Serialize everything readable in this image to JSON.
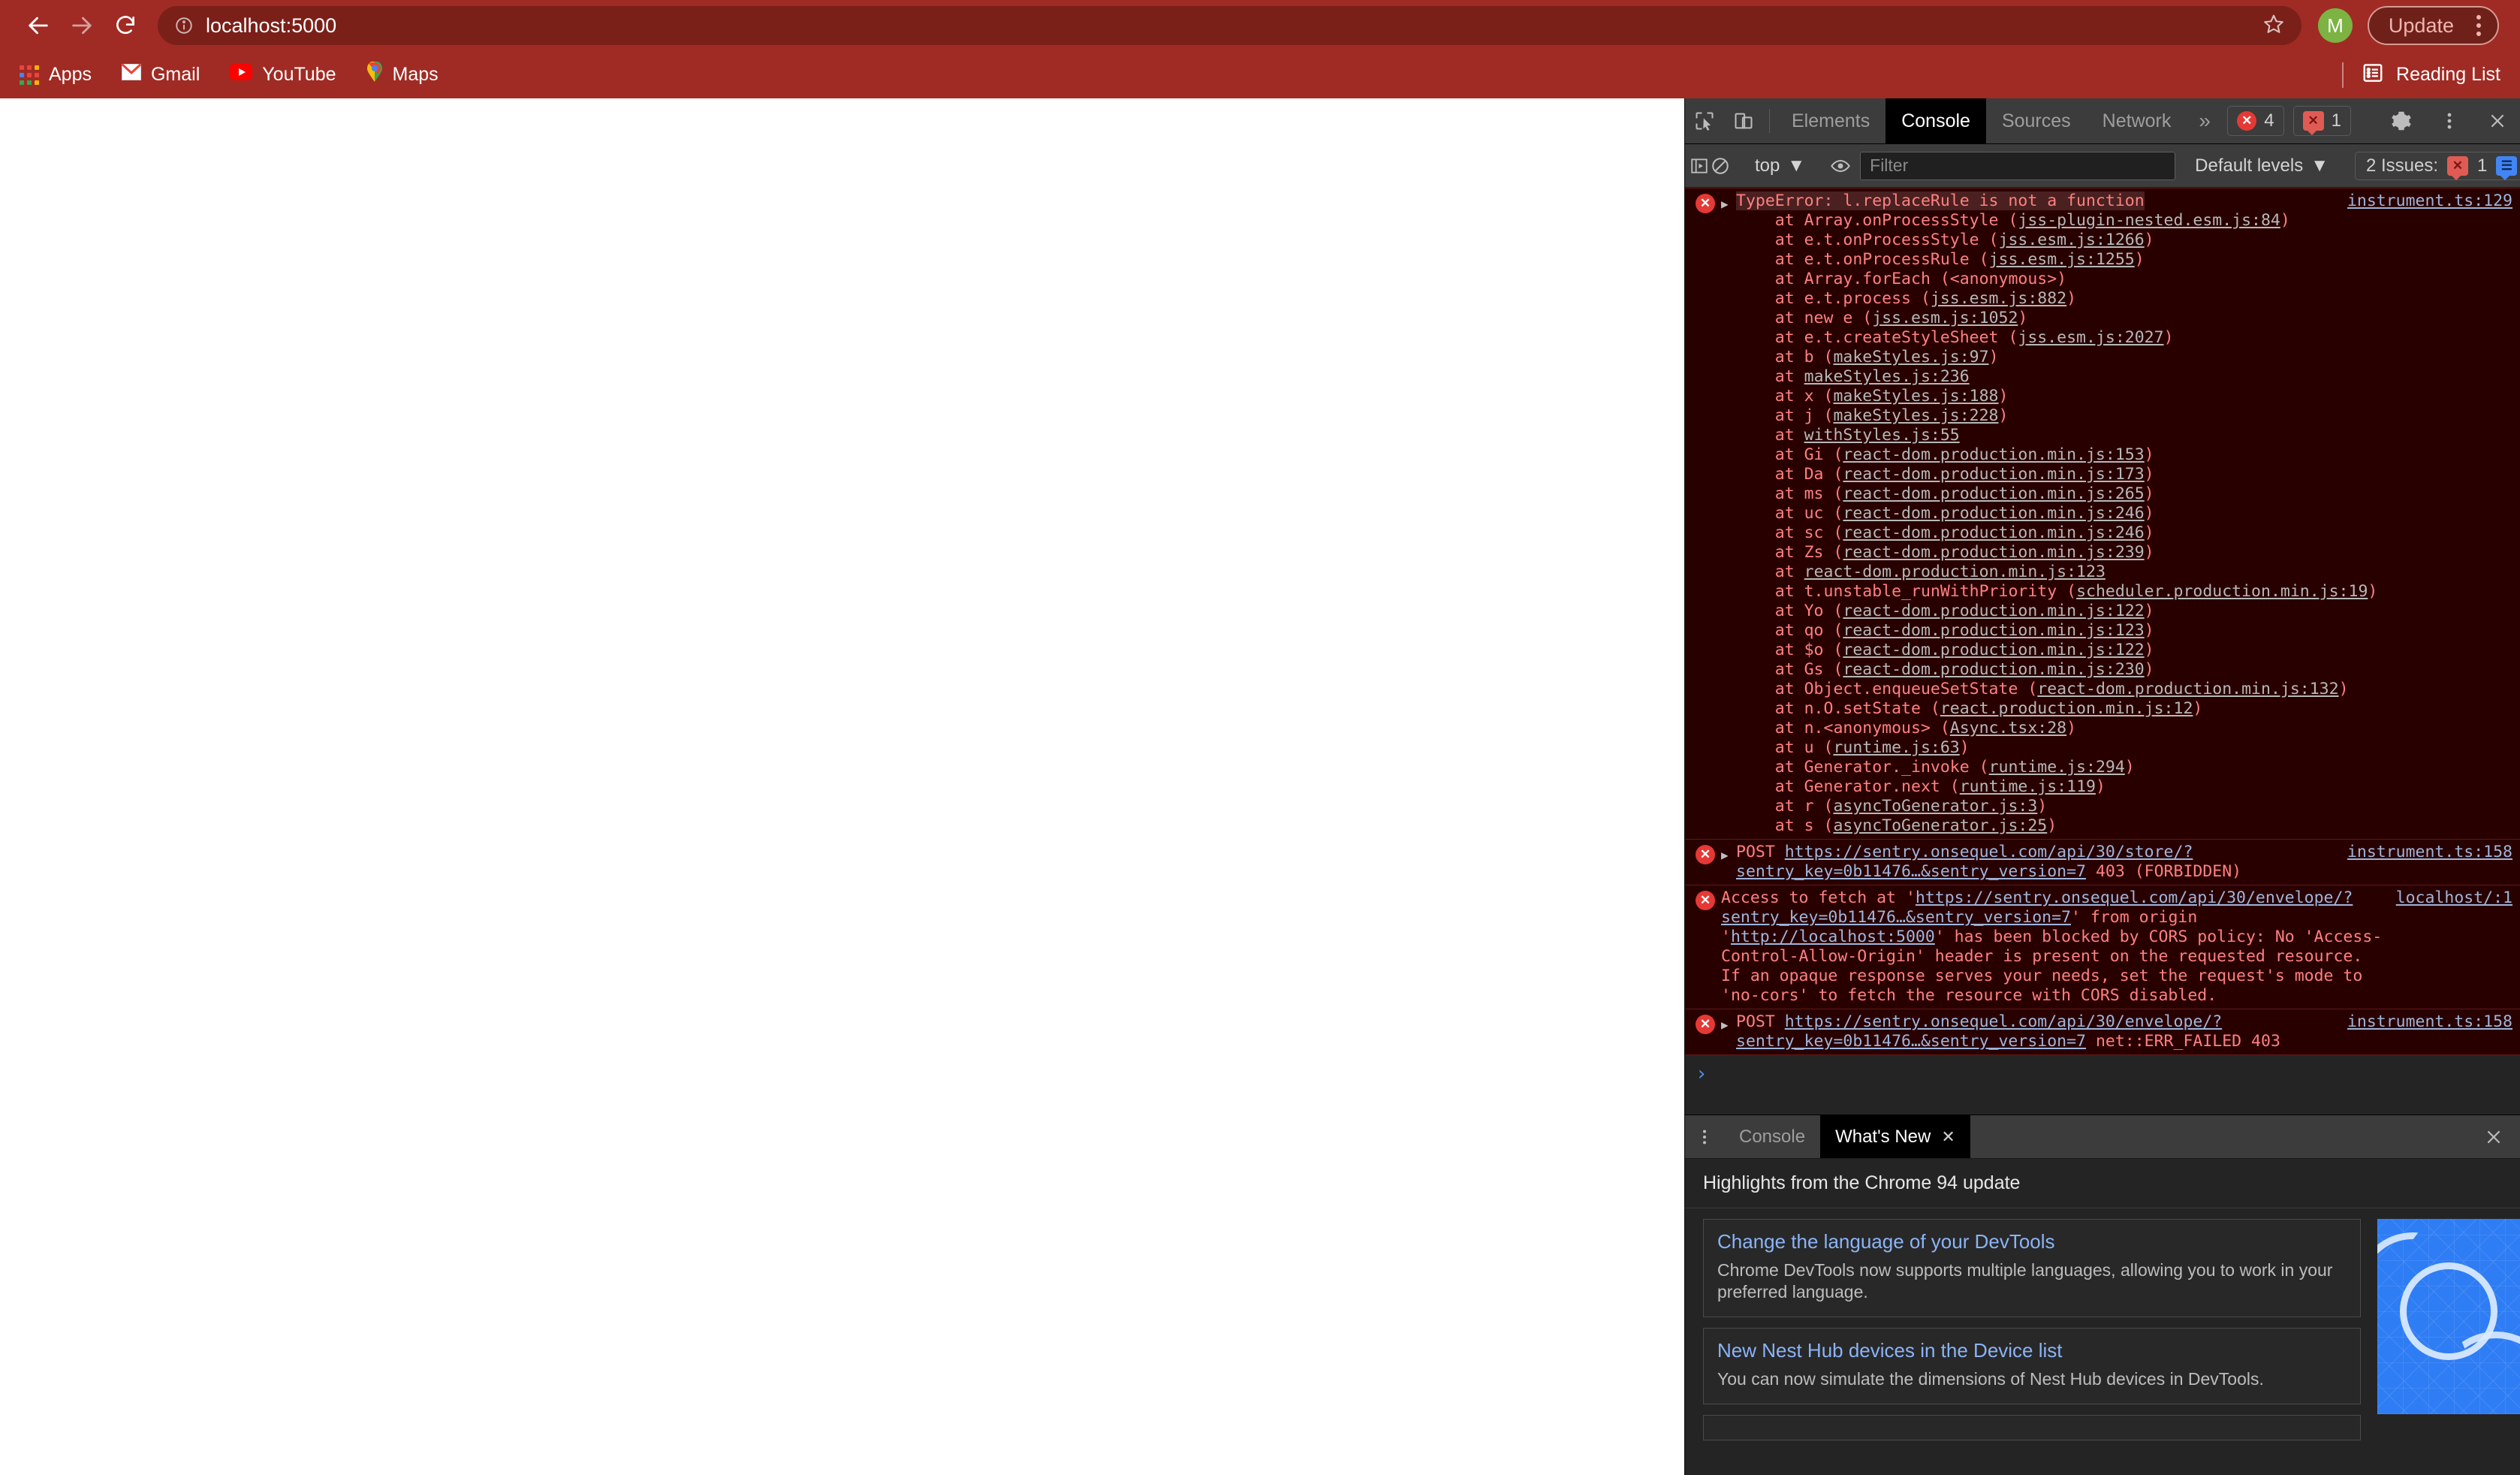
{
  "browser": {
    "nav": {
      "back_icon": "arrow-left-icon",
      "forward_icon": "arrow-right-icon",
      "reload_icon": "reload-icon"
    },
    "omnibox": {
      "url": "localhost:5000",
      "info_icon": "page-info-icon",
      "star_icon": "bookmark-star-icon"
    },
    "profile": {
      "initial": "M"
    },
    "update_button": {
      "label": "Update"
    },
    "menu_icon": "kebab-menu-icon",
    "bookmarks": [
      {
        "label": "Apps",
        "icon": "apps-grid-icon"
      },
      {
        "label": "Gmail",
        "icon": "gmail-icon"
      },
      {
        "label": "YouTube",
        "icon": "youtube-icon"
      },
      {
        "label": "Maps",
        "icon": "maps-pin-icon"
      }
    ],
    "reading_list": {
      "label": "Reading List",
      "icon": "reading-list-icon"
    }
  },
  "devtools": {
    "tabbar": {
      "inspect_icon": "inspect-element-icon",
      "device_icon": "device-toolbar-icon",
      "tabs": [
        {
          "label": "Elements",
          "active": false
        },
        {
          "label": "Console",
          "active": true
        },
        {
          "label": "Sources",
          "active": false
        },
        {
          "label": "Network",
          "active": false
        }
      ],
      "more_tabs_icon": "chevron-double-right-icon",
      "error_count": "4",
      "issue_count": "1",
      "settings_icon": "gear-icon",
      "more_icon": "kebab-menu-icon",
      "close_icon": "close-icon"
    },
    "toolbar": {
      "sidebar_icon": "console-sidebar-icon",
      "clear_icon": "clear-console-icon",
      "context": "top",
      "eye_icon": "live-expression-icon",
      "filter_placeholder": "Filter",
      "filter_value": "",
      "levels": "Default levels",
      "issues_label": "2 Issues:",
      "issues_error_count": "1",
      "issues_info_count": "1",
      "settings_icon": "gear-icon"
    },
    "console": {
      "messages": [
        {
          "type": "error-stack",
          "icon": "error-icon",
          "expandable": true,
          "header": "TypeError: l.replaceRule is not a function",
          "source": "instrument.ts:129",
          "stack": [
            {
              "fn": "at Array.onProcessStyle (",
              "loc": "jss-plugin-nested.esm.js:84",
              "tail": ")"
            },
            {
              "fn": "at e.t.onProcessStyle (",
              "loc": "jss.esm.js:1266",
              "tail": ")"
            },
            {
              "fn": "at e.t.onProcessRule (",
              "loc": "jss.esm.js:1255",
              "tail": ")"
            },
            {
              "fn": "at Array.forEach (<anonymous>)",
              "loc": "",
              "tail": ""
            },
            {
              "fn": "at e.t.process (",
              "loc": "jss.esm.js:882",
              "tail": ")"
            },
            {
              "fn": "at new e (",
              "loc": "jss.esm.js:1052",
              "tail": ")"
            },
            {
              "fn": "at e.t.createStyleSheet (",
              "loc": "jss.esm.js:2027",
              "tail": ")"
            },
            {
              "fn": "at b (",
              "loc": "makeStyles.js:97",
              "tail": ")"
            },
            {
              "fn": "at ",
              "loc": "makeStyles.js:236",
              "tail": ""
            },
            {
              "fn": "at x (",
              "loc": "makeStyles.js:188",
              "tail": ")"
            },
            {
              "fn": "at j (",
              "loc": "makeStyles.js:228",
              "tail": ")"
            },
            {
              "fn": "at ",
              "loc": "withStyles.js:55",
              "tail": ""
            },
            {
              "fn": "at Gi (",
              "loc": "react-dom.production.min.js:153",
              "tail": ")"
            },
            {
              "fn": "at Da (",
              "loc": "react-dom.production.min.js:173",
              "tail": ")"
            },
            {
              "fn": "at ms (",
              "loc": "react-dom.production.min.js:265",
              "tail": ")"
            },
            {
              "fn": "at uc (",
              "loc": "react-dom.production.min.js:246",
              "tail": ")"
            },
            {
              "fn": "at sc (",
              "loc": "react-dom.production.min.js:246",
              "tail": ")"
            },
            {
              "fn": "at Zs (",
              "loc": "react-dom.production.min.js:239",
              "tail": ")"
            },
            {
              "fn": "at ",
              "loc": "react-dom.production.min.js:123",
              "tail": ""
            },
            {
              "fn": "at t.unstable_runWithPriority (",
              "loc": "scheduler.production.min.js:19",
              "tail": ")"
            },
            {
              "fn": "at Yo (",
              "loc": "react-dom.production.min.js:122",
              "tail": ")"
            },
            {
              "fn": "at qo (",
              "loc": "react-dom.production.min.js:123",
              "tail": ")"
            },
            {
              "fn": "at $o (",
              "loc": "react-dom.production.min.js:122",
              "tail": ")"
            },
            {
              "fn": "at Gs (",
              "loc": "react-dom.production.min.js:230",
              "tail": ")"
            },
            {
              "fn": "at Object.enqueueSetState (",
              "loc": "react-dom.production.min.js:132",
              "tail": ")"
            },
            {
              "fn": "at n.O.setState (",
              "loc": "react.production.min.js:12",
              "tail": ")"
            },
            {
              "fn": "at n.<anonymous> (",
              "loc": "Async.tsx:28",
              "tail": ")"
            },
            {
              "fn": "at u (",
              "loc": "runtime.js:63",
              "tail": ")"
            },
            {
              "fn": "at Generator._invoke (",
              "loc": "runtime.js:294",
              "tail": ")"
            },
            {
              "fn": "at Generator.next (",
              "loc": "runtime.js:119",
              "tail": ")"
            },
            {
              "fn": "at r (",
              "loc": "asyncToGenerator.js:3",
              "tail": ")"
            },
            {
              "fn": "at s (",
              "loc": "asyncToGenerator.js:25",
              "tail": ")"
            }
          ]
        },
        {
          "type": "network-error",
          "icon": "error-icon",
          "expandable": true,
          "method": "POST",
          "url": "https://sentry.onsequel.com/api/30/store/?sentry_key=0b11476…&sentry_version=7",
          "status": "403 (FORBIDDEN)",
          "source": "instrument.ts:158"
        },
        {
          "type": "cors-error",
          "icon": "error-icon",
          "expandable": false,
          "text_a": "Access to fetch at '",
          "link_a": "https://sentry.onsequel.com/api/30/envelope/?sentry_key=0b11476…&sentry_version=7",
          "text_b": "' from origin '",
          "link_b": "http://localhost:5000",
          "text_c": "' has been blocked by CORS policy: No 'Access-Control-Allow-Origin' header is present on the requested resource. If an opaque response serves your needs, set the request's mode to 'no-cors' to fetch the resource with CORS disabled.",
          "source": "localhost/:1"
        },
        {
          "type": "network-error",
          "icon": "error-icon",
          "expandable": true,
          "method": "POST",
          "url": "https://sentry.onsequel.com/api/30/envelope/?sentry_key=0b11476…&sentry_version=7",
          "status": "net::ERR_FAILED 403",
          "source": "instrument.ts:158"
        }
      ],
      "prompt_chevron": "›"
    },
    "drawer": {
      "more_icon": "kebab-menu-icon",
      "tabs": [
        {
          "label": "Console",
          "active": false,
          "closable": false
        },
        {
          "label": "What's New",
          "active": true,
          "closable": true,
          "close_icon": "close-icon"
        }
      ],
      "close_icon": "close-icon",
      "whats_new": {
        "heading": "Highlights from the Chrome 94 update",
        "cards": [
          {
            "title": "Change the language of your DevTools",
            "desc": "Chrome DevTools now supports multiple languages, allowing you to work in your preferred language."
          },
          {
            "title": "New Nest Hub devices in the Device list",
            "desc": "You can now simulate the dimensions of Nest Hub devices in DevTools."
          }
        ],
        "aside_icon": "chrome-blueprint-logo"
      }
    }
  },
  "colors": {
    "browser_chrome": "#a02b24",
    "omnibox": "#7a2019",
    "devtools_bg": "#242424",
    "devtools_toolbar": "#3c3c3c",
    "error_bg": "#290000",
    "error_text": "#ff8080",
    "link_blue": "#8ab4f8",
    "accent_green": "#7cb342"
  }
}
